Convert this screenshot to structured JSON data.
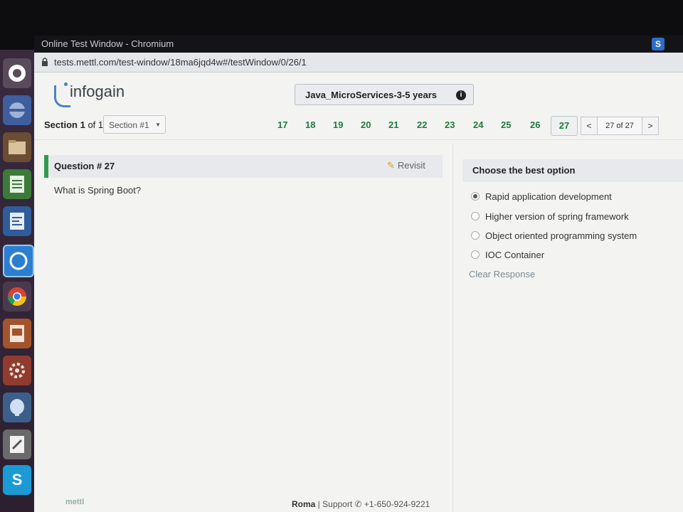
{
  "window": {
    "title": "Online Test Window - Chromium",
    "url": "tests.mettl.com/test-window/18ma6jqd4w#/testWindow/0/26/1",
    "badge": "S"
  },
  "launcher": {
    "icons": [
      "ubuntu-logo-icon",
      "system-settings-icon",
      "files-icon",
      "spreadsheet-icon",
      "document-icon",
      "browser-icon",
      "chrome-icon",
      "presentation-icon",
      "software-center-icon",
      "postgresql-icon",
      "text-editor-icon",
      "skype-icon"
    ],
    "skype_label": "S"
  },
  "header": {
    "logo_text": "infogain",
    "test_name": "Java_MicroServices-3-5 years",
    "info_symbol": "i"
  },
  "section": {
    "label": "Section",
    "current": "1",
    "of_text": "of 1",
    "select_value": "Section #1"
  },
  "question_numbers": [
    "17",
    "18",
    "19",
    "20",
    "21",
    "22",
    "23",
    "24",
    "25",
    "26"
  ],
  "current_question_number": "27",
  "pager": {
    "prev": "<",
    "text": "27 of 27",
    "next": ">"
  },
  "question": {
    "title": "Question # 27",
    "revisit": "Revisit",
    "text": "What is Spring Boot?"
  },
  "options": {
    "header": "Choose the best option",
    "items": [
      {
        "label": "Rapid application development",
        "selected": true
      },
      {
        "label": "Higher version of spring framework",
        "selected": false
      },
      {
        "label": "Object oriented programming system",
        "selected": false
      },
      {
        "label": "IOC Container",
        "selected": false
      }
    ],
    "clear": "Clear Response"
  },
  "footer": {
    "brand": "mettl",
    "location": "Roma",
    "support_label": "Support",
    "phone": "+1-650-924-9221"
  },
  "colors": {
    "accent_green": "#2f9b4b",
    "question_number_green": "#1f7a3d",
    "logo_blue": "#4a82c4"
  }
}
